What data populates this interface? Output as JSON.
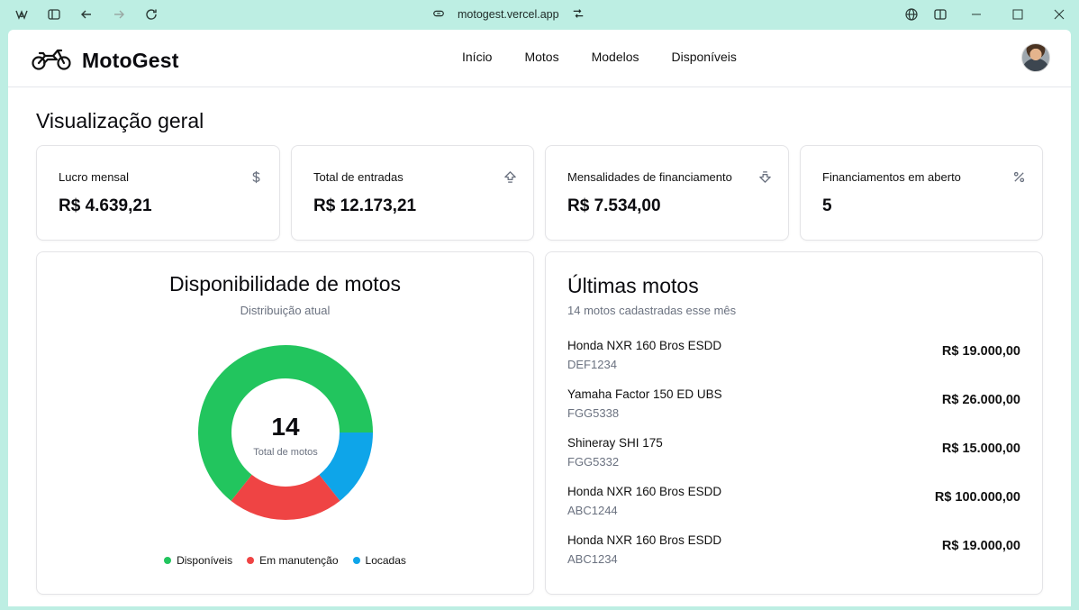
{
  "browser": {
    "url": "motogest.vercel.app",
    "icons": [
      "app-logo-icon",
      "sidebar-toggle-icon",
      "back-icon",
      "forward-icon",
      "reload-icon",
      "site-info-icon",
      "tune-icon",
      "globe-icon",
      "split-view-icon",
      "minimize-icon",
      "maximize-icon",
      "close-icon"
    ]
  },
  "header": {
    "brand": "MotoGest",
    "brand_icon": "motorcycle-icon",
    "nav": [
      "Início",
      "Motos",
      "Modelos",
      "Disponíveis"
    ]
  },
  "page_title": "Visualização geral",
  "stats": [
    {
      "label": "Lucro mensal",
      "value": "R$ 4.639,21",
      "icon": "dollar-icon"
    },
    {
      "label": "Total de entradas",
      "value": "R$ 12.173,21",
      "icon": "arrow-up-icon"
    },
    {
      "label": "Mensalidades de financiamento",
      "value": "R$ 7.534,00",
      "icon": "arrow-down-icon"
    },
    {
      "label": "Financiamentos em aberto",
      "value": "5",
      "icon": "percent-icon"
    }
  ],
  "availability": {
    "title": "Disponibilidade de motos",
    "subtitle": "Distribuição atual",
    "total": "14",
    "total_label": "Total de motos"
  },
  "chart_data": {
    "type": "pie",
    "title": "Disponibilidade de motos",
    "categories": [
      "Disponíveis",
      "Em manutenção",
      "Locadas"
    ],
    "values": [
      9,
      3,
      2
    ],
    "colors": [
      "#22c55e",
      "#ef4444",
      "#0ea5e9"
    ]
  },
  "latest": {
    "title": "Últimas motos",
    "subtitle": "14 motos cadastradas esse mês",
    "items": [
      {
        "name": "Honda NXR 160 Bros ESDD",
        "plate": "DEF1234",
        "price": "R$ 19.000,00"
      },
      {
        "name": "Yamaha Factor 150 ED UBS",
        "plate": "FGG5338",
        "price": "R$ 26.000,00"
      },
      {
        "name": "Shineray SHI 175",
        "plate": "FGG5332",
        "price": "R$ 15.000,00"
      },
      {
        "name": "Honda NXR 160 Bros ESDD",
        "plate": "ABC1244",
        "price": "R$ 100.000,00"
      },
      {
        "name": "Honda NXR 160 Bros ESDD",
        "plate": "ABC1234",
        "price": "R$ 19.000,00"
      }
    ]
  }
}
